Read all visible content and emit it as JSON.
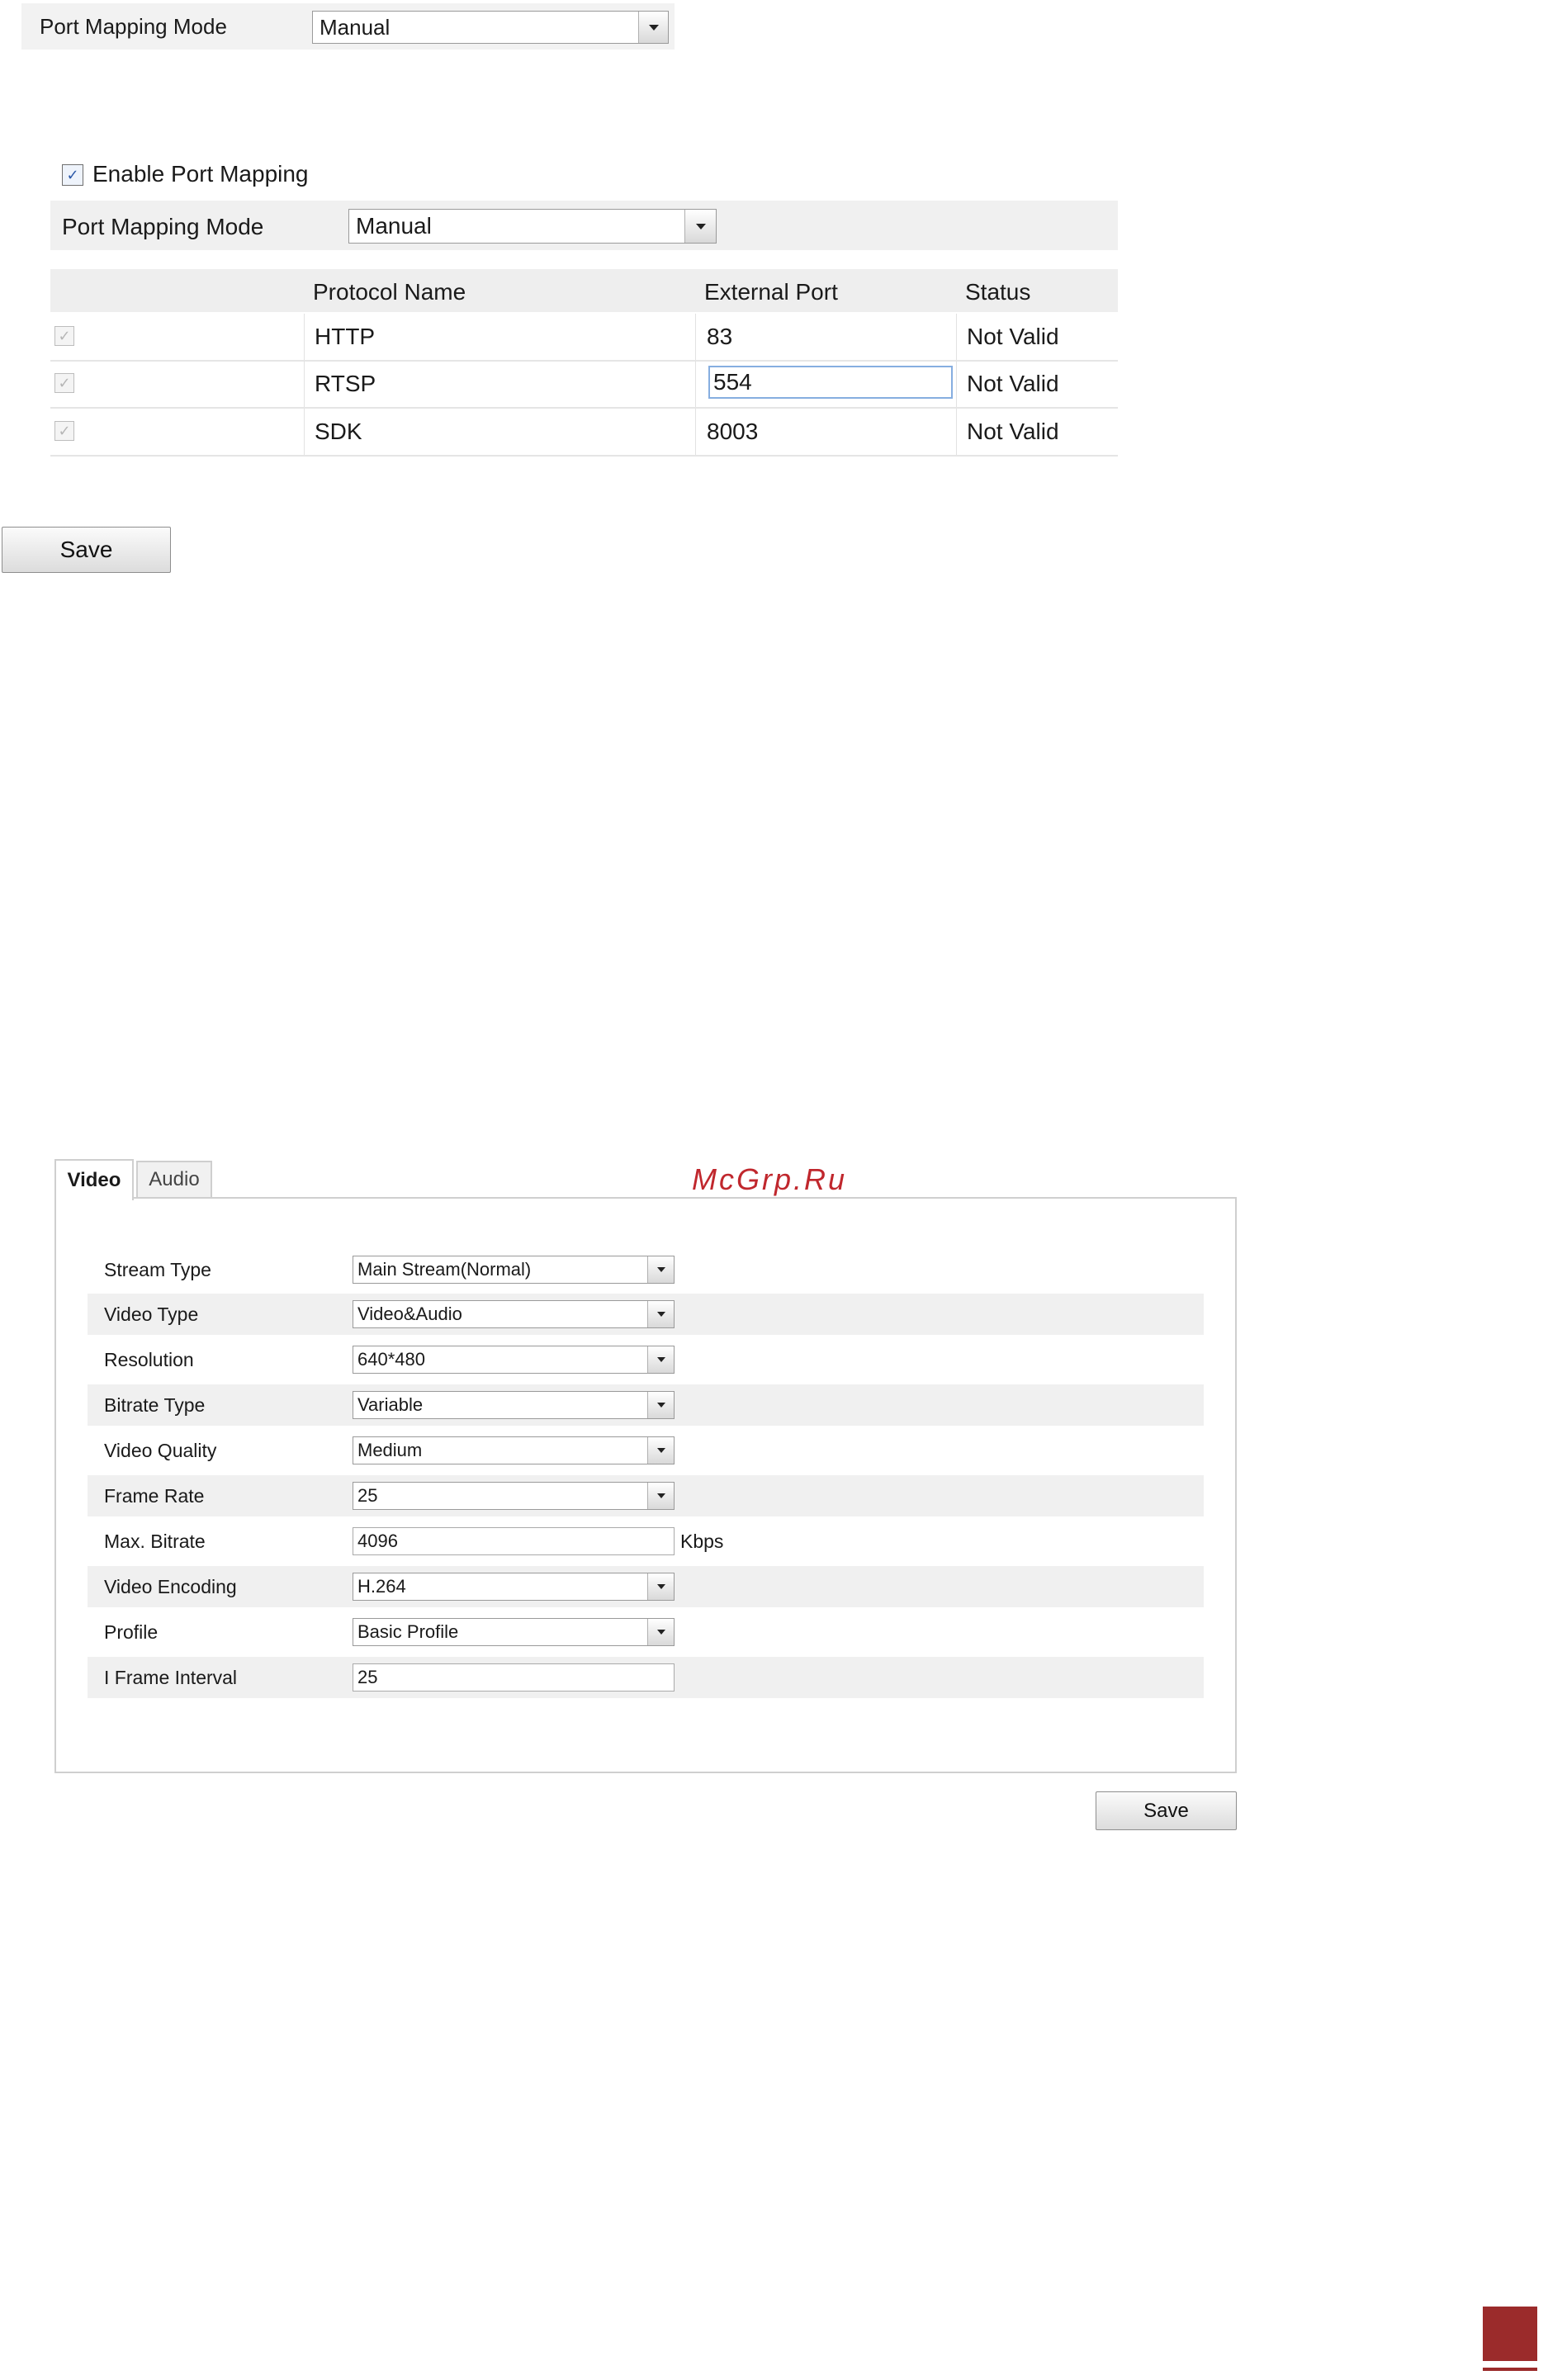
{
  "section1": {
    "label": "Port Mapping Mode",
    "select_value": "Manual"
  },
  "section2": {
    "enable_label": "Enable Port Mapping",
    "mode_label": "Port Mapping Mode",
    "mode_value": "Manual",
    "columns": [
      "Protocol Name",
      "External Port",
      "Status"
    ],
    "rows": [
      {
        "protocol": "HTTP",
        "port": "83",
        "status": "Not Valid"
      },
      {
        "protocol": "RTSP",
        "port": "554",
        "status": "Not Valid"
      },
      {
        "protocol": "SDK",
        "port": "8003",
        "status": "Not Valid"
      }
    ],
    "save_label": "Save"
  },
  "section3": {
    "tabs": [
      "Video",
      "Audio"
    ],
    "fields": [
      {
        "label": "Stream Type",
        "value": "Main Stream(Normal)"
      },
      {
        "label": "Video Type",
        "value": "Video&Audio"
      },
      {
        "label": "Resolution",
        "value": "640*480"
      },
      {
        "label": "Bitrate Type",
        "value": "Variable"
      },
      {
        "label": "Video Quality",
        "value": "Medium"
      },
      {
        "label": "Frame Rate",
        "value": "25"
      },
      {
        "label": "Max. Bitrate",
        "value": "4096",
        "unit": "Kbps"
      },
      {
        "label": "Video Encoding",
        "value": "H.264"
      },
      {
        "label": "Profile",
        "value": "Basic Profile"
      },
      {
        "label": "I Frame Interval",
        "value": "25"
      }
    ],
    "save_label": "Save"
  },
  "watermark": "McGrp.Ru",
  "colors": {
    "watermark": "#c0272d",
    "corner_mark": "#9b2b2b",
    "check_accent": "#2b58a8"
  }
}
